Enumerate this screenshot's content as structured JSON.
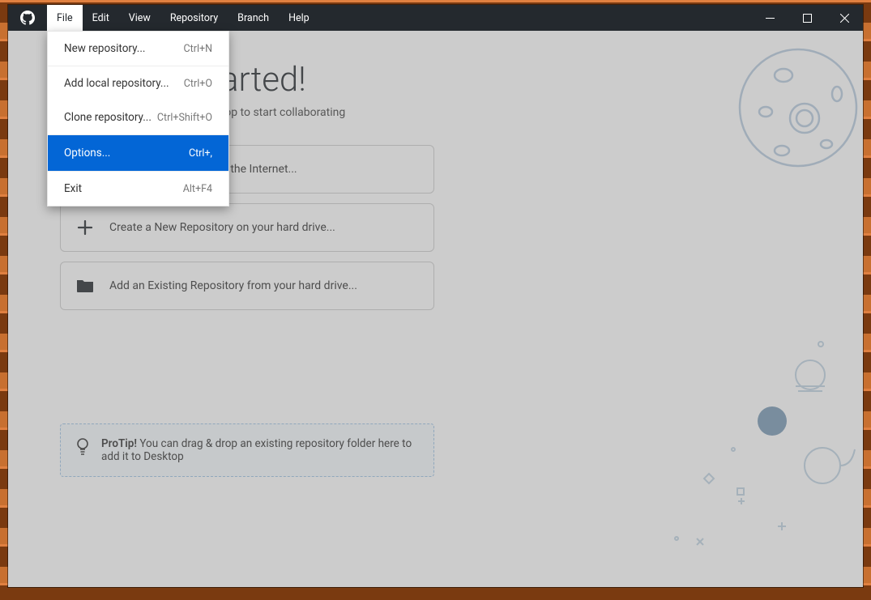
{
  "menubar": {
    "items": [
      {
        "label": "File"
      },
      {
        "label": "Edit"
      },
      {
        "label": "View"
      },
      {
        "label": "Repository"
      },
      {
        "label": "Branch"
      },
      {
        "label": "Help"
      }
    ]
  },
  "file_menu": {
    "new_repo": {
      "label": "New repository...",
      "shortcut": "Ctrl+N"
    },
    "add_local": {
      "label": "Add local repository...",
      "shortcut": "Ctrl+O"
    },
    "clone": {
      "label": "Clone repository...",
      "shortcut": "Ctrl+Shift+O"
    },
    "options": {
      "label": "Options...",
      "shortcut": "Ctrl+,"
    },
    "exit": {
      "label": "Exit",
      "shortcut": "Alt+F4"
    }
  },
  "main": {
    "heading": "Let's get started!",
    "subtitle": "Add a repository to GitHub Desktop to start collaborating",
    "actions": {
      "clone": "Clone a repository from the Internet...",
      "create": "Create a New Repository on your hard drive...",
      "add": "Add an Existing Repository from your hard drive..."
    },
    "protip_label": "ProTip!",
    "protip_text": " You can drag & drop an existing repository folder here to add it to Desktop"
  }
}
